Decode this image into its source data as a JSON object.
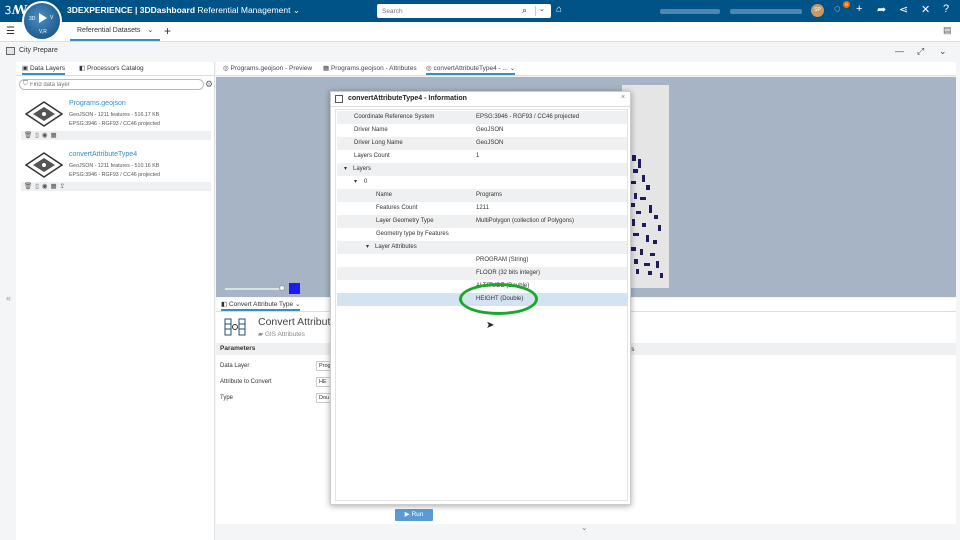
{
  "app": {
    "brand": "3DEXPERIENCE | 3DDashboard",
    "dashboard": "Referential Management",
    "compass_left": "3D",
    "compass_right": "V",
    "compass_bottom": "V,R"
  },
  "search": {
    "placeholder": "Search"
  },
  "user": {
    "initials": "SP",
    "notif_count": "8"
  },
  "dashboard_tab": {
    "label": "Referential Datasets"
  },
  "widget": {
    "title": "City Prepare"
  },
  "left_panel": {
    "tabs": [
      "Data Layers",
      "Processors Catalog"
    ],
    "filter_placeholder": "Find data layer",
    "datasets": [
      {
        "name": "Programs.geojson",
        "info1": "GeoJSON - 1211 features - 516.17 KB",
        "info2": "EPSG:3946 - RGF93 / CC46 projected"
      },
      {
        "name": "convertAttributeType4",
        "info1": "GeoJSON - 1211 features - 510.16 KB",
        "info2": "EPSG:3946 - RGF93 / CC46 projected"
      }
    ]
  },
  "main_tabs": [
    "Programs.geojson - Preview",
    "Programs.geojson - Attributes",
    "convertAttributeType4 - ..."
  ],
  "map": {
    "swatch_color": "#1c1cf0"
  },
  "bottom": {
    "tab_label": "Convert Attribute Type",
    "category_title": "Convert Attribute",
    "category_sub": "GIS Attributes",
    "parameters_label": "Parameters",
    "params": [
      {
        "label": "Data Layer",
        "value": "Prog"
      },
      {
        "label": "Attribute to Convert",
        "value": "HE"
      },
      {
        "label": "Type",
        "value": "Dou"
      }
    ],
    "right_fragment": "ars",
    "run_label": "Run"
  },
  "dialog": {
    "title": "convertAttributeType4 - Information",
    "rows": [
      {
        "key": "Coordinate Reference System",
        "value": "EPSG:3946 - RGF93 / CC46 projected"
      },
      {
        "key": "Driver Name",
        "value": "GeoJSON"
      },
      {
        "key": "Driver Long Name",
        "value": "GeoJSON"
      },
      {
        "key": "Layers Count",
        "value": "1"
      },
      {
        "key": "Layers",
        "value": ""
      },
      {
        "key": "0",
        "value": ""
      },
      {
        "key": "Name",
        "value": "Programs"
      },
      {
        "key": "Features Count",
        "value": "1211"
      },
      {
        "key": "Layer Geometry Type",
        "value": "MultiPolygon (collection of Polygons)"
      },
      {
        "key": "Geometry type by Features",
        "value": ""
      },
      {
        "key": "Layer Attributes",
        "value": ""
      },
      {
        "key": "",
        "value": "PROGRAM (String)"
      },
      {
        "key": "",
        "value": "FLOOR (32 bits integer)"
      },
      {
        "key": "",
        "value": "ALTITUDE (Double)"
      },
      {
        "key": "",
        "value": "HEIGHT (Double)"
      }
    ]
  }
}
